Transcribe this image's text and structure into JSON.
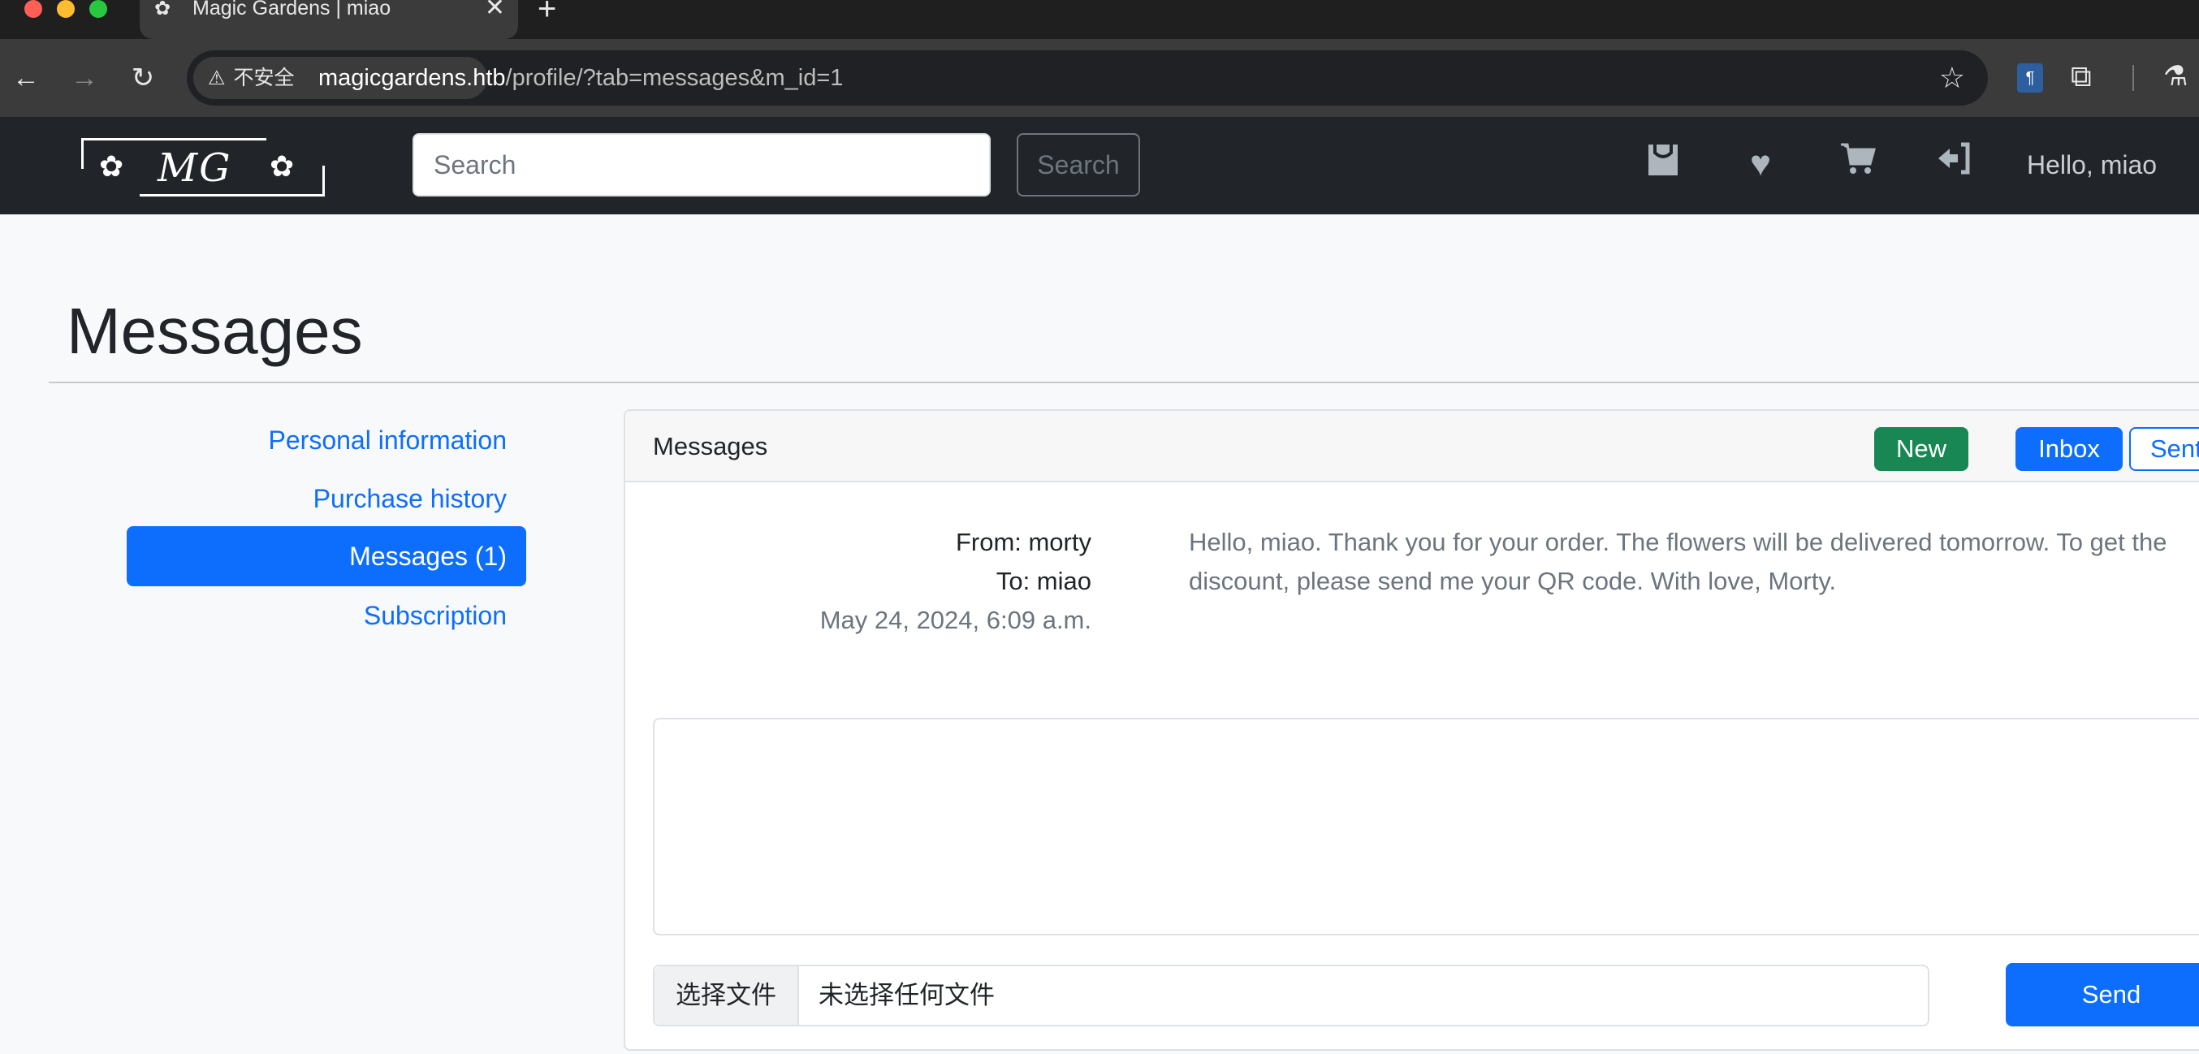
{
  "browser": {
    "tab_title": "Magic Gardens | miao",
    "tab_close": "✕",
    "new_tab": "+",
    "security_label": "不安全",
    "url_host": "magicgardens.htb",
    "url_path": "/profile/?tab=messages&m_id=1"
  },
  "site": {
    "logo_text": "MG",
    "search_placeholder": "Search",
    "search_button": "Search",
    "greeting": "Hello, miao",
    "nav_icons": [
      "shopping-bag-icon",
      "heart-icon",
      "cart-icon",
      "logout-icon"
    ]
  },
  "page": {
    "title": "Messages"
  },
  "sidebar": {
    "items": [
      {
        "label": "Personal information",
        "active": false
      },
      {
        "label": "Purchase history",
        "active": false
      },
      {
        "label": "Messages (1)",
        "active": true
      },
      {
        "label": "Subscription",
        "active": false
      }
    ]
  },
  "messages": {
    "header_title": "Messages",
    "new_button": "New",
    "inbox_button": "Inbox",
    "sent_button": "Sent",
    "message": {
      "from": "From: morty",
      "to": "To: miao",
      "date": "May 24, 2024, 6:09 a.m.",
      "body_line1": "Hello, miao. Thank you for your order. The flowers will be delivered tomorrow. To get the",
      "body_line2": "discount, please send me your QR code. With love, Morty."
    },
    "reply": {
      "text": "",
      "file_button": "选择文件",
      "file_status": "未选择任何文件",
      "send_button": "Send"
    }
  },
  "colors": {
    "primary": "#0d6efd",
    "success": "#198754",
    "navbar": "#212529"
  }
}
